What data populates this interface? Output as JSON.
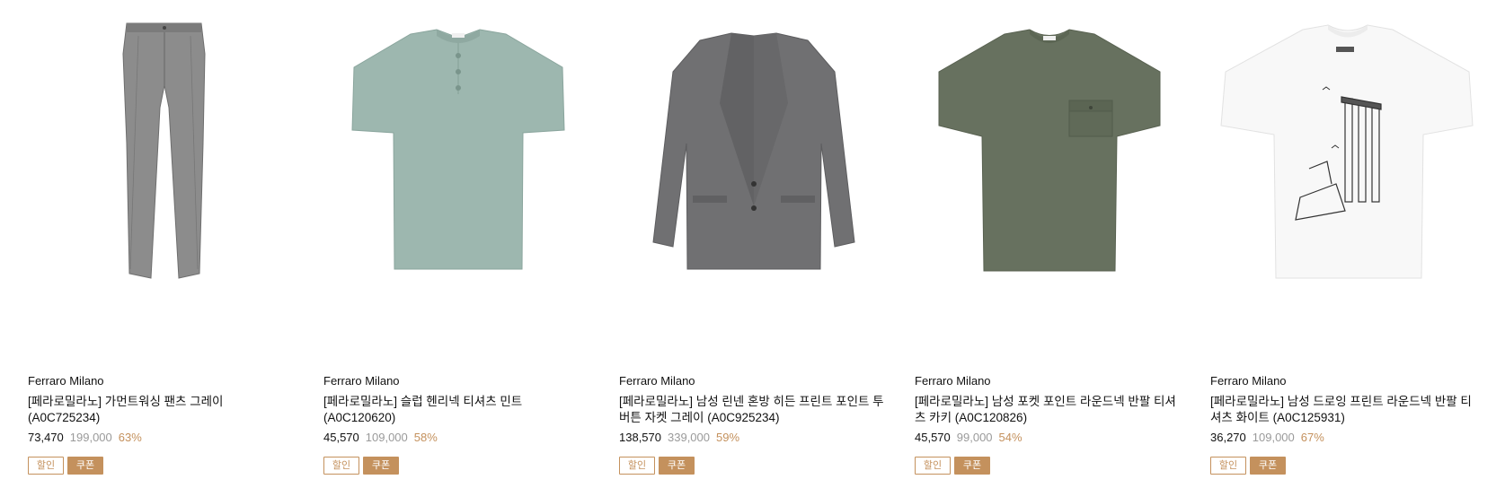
{
  "products": [
    {
      "brand": "Ferraro Milano",
      "title": "[페라로밀라노] 가먼트워싱 팬츠 그레이 (A0C725234)",
      "price": "73,470",
      "original_price": "199,000",
      "discount": "63%",
      "badges": {
        "sale": "할인",
        "coupon": "쿠폰"
      },
      "image": {
        "item": "pants",
        "color": "#8a8a8a"
      }
    },
    {
      "brand": "Ferraro Milano",
      "title": "[페라로밀라노] 슬럽 헨리넥 티셔츠 민트 (A0C120620)",
      "price": "45,570",
      "original_price": "109,000",
      "discount": "58%",
      "badges": {
        "sale": "할인",
        "coupon": "쿠폰"
      },
      "image": {
        "item": "henley-tshirt",
        "color": "#97b2aa"
      }
    },
    {
      "brand": "Ferraro Milano",
      "title": "[페라로밀라노] 남성 린넨 혼방 히든 프린트 포인트 투버튼 자켓 그레이 (A0C925234)",
      "price": "138,570",
      "original_price": "339,000",
      "discount": "59%",
      "badges": {
        "sale": "할인",
        "coupon": "쿠폰"
      },
      "image": {
        "item": "jacket",
        "color": "#6d6d6f"
      }
    },
    {
      "brand": "Ferraro Milano",
      "title": "[페라로밀라노] 남성 포켓 포인트 라운드넥 반팔 티셔츠 카키 (A0C120826)",
      "price": "45,570",
      "original_price": "99,000",
      "discount": "54%",
      "badges": {
        "sale": "할인",
        "coupon": "쿠폰"
      },
      "image": {
        "item": "pocket-tshirt",
        "color": "#66705f"
      }
    },
    {
      "brand": "Ferraro Milano",
      "title": "[페라로밀라노] 남성 드로잉 프린트 라운드넥 반팔 티셔츠 화이트 (A0C125931)",
      "price": "36,270",
      "original_price": "109,000",
      "discount": "67%",
      "badges": {
        "sale": "할인",
        "coupon": "쿠폰"
      },
      "image": {
        "item": "print-tshirt",
        "color": "#f7f7f7"
      }
    }
  ],
  "colors": {
    "accent": "#c4915d",
    "strike_price": "#9a9a9a",
    "text": "#111111"
  }
}
